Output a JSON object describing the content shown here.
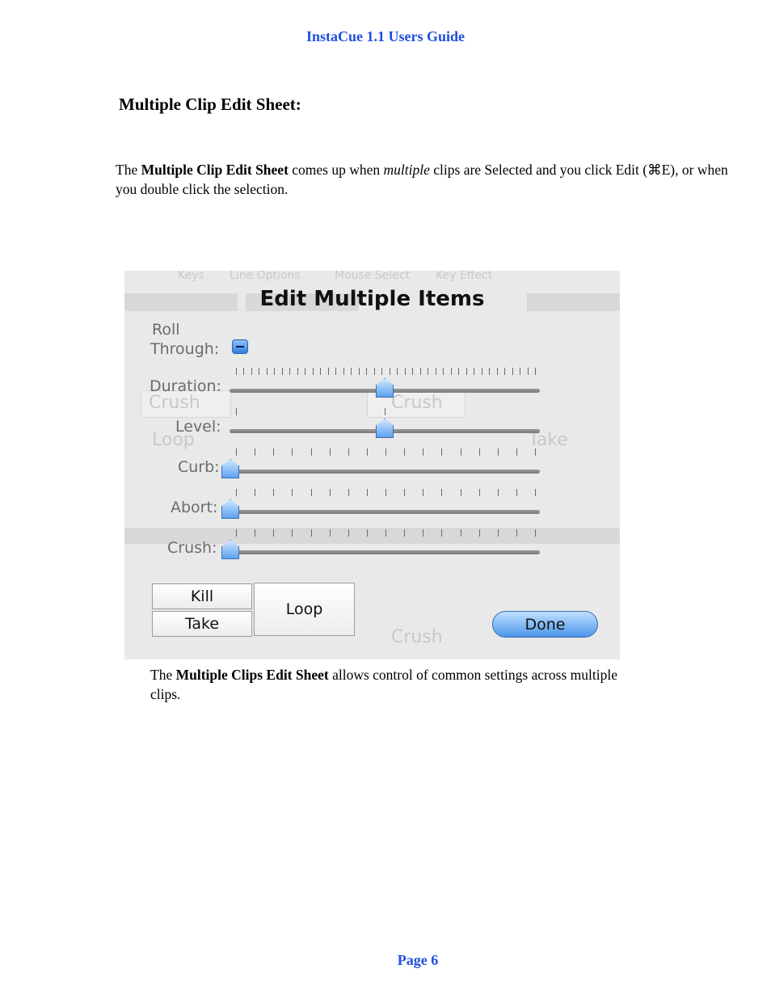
{
  "header": {
    "title": "InstaCue 1.1 Users Guide"
  },
  "section": {
    "title": "Multiple Clip Edit Sheet:"
  },
  "intro": {
    "t1": "The ",
    "b1": "Multiple Clip Edit Sheet",
    "t2": " comes up when ",
    "i1": "multiple",
    "t3": " clips are Selected and you click Edit (⌘E), or when you double click the selection."
  },
  "dialog": {
    "title": "Edit Multiple Items",
    "roll_line1": "Roll",
    "roll_line2": "Through:",
    "sliders": [
      {
        "label": "Duration:",
        "value": 0.5
      },
      {
        "label": "Level:",
        "value": 0.5
      },
      {
        "label": "Curb:",
        "value": 0.0
      },
      {
        "label": "Abort:",
        "value": 0.0
      },
      {
        "label": "Crush:",
        "value": 0.0
      }
    ],
    "buttons": {
      "kill": "Kill",
      "take": "Take",
      "loop": "Loop",
      "done": "Done"
    }
  },
  "background_ghost": {
    "tabs": [
      "Keys",
      "Line Options",
      "Mouse Select",
      "Key Effect"
    ],
    "crush": "Crush",
    "loop": "Loop",
    "take": "Take"
  },
  "caption": {
    "t1": "The ",
    "b1": "Multiple Clips Edit Sheet",
    "t2": " allows control of common settings across multiple clips."
  },
  "footer": {
    "page": "Page 6"
  }
}
